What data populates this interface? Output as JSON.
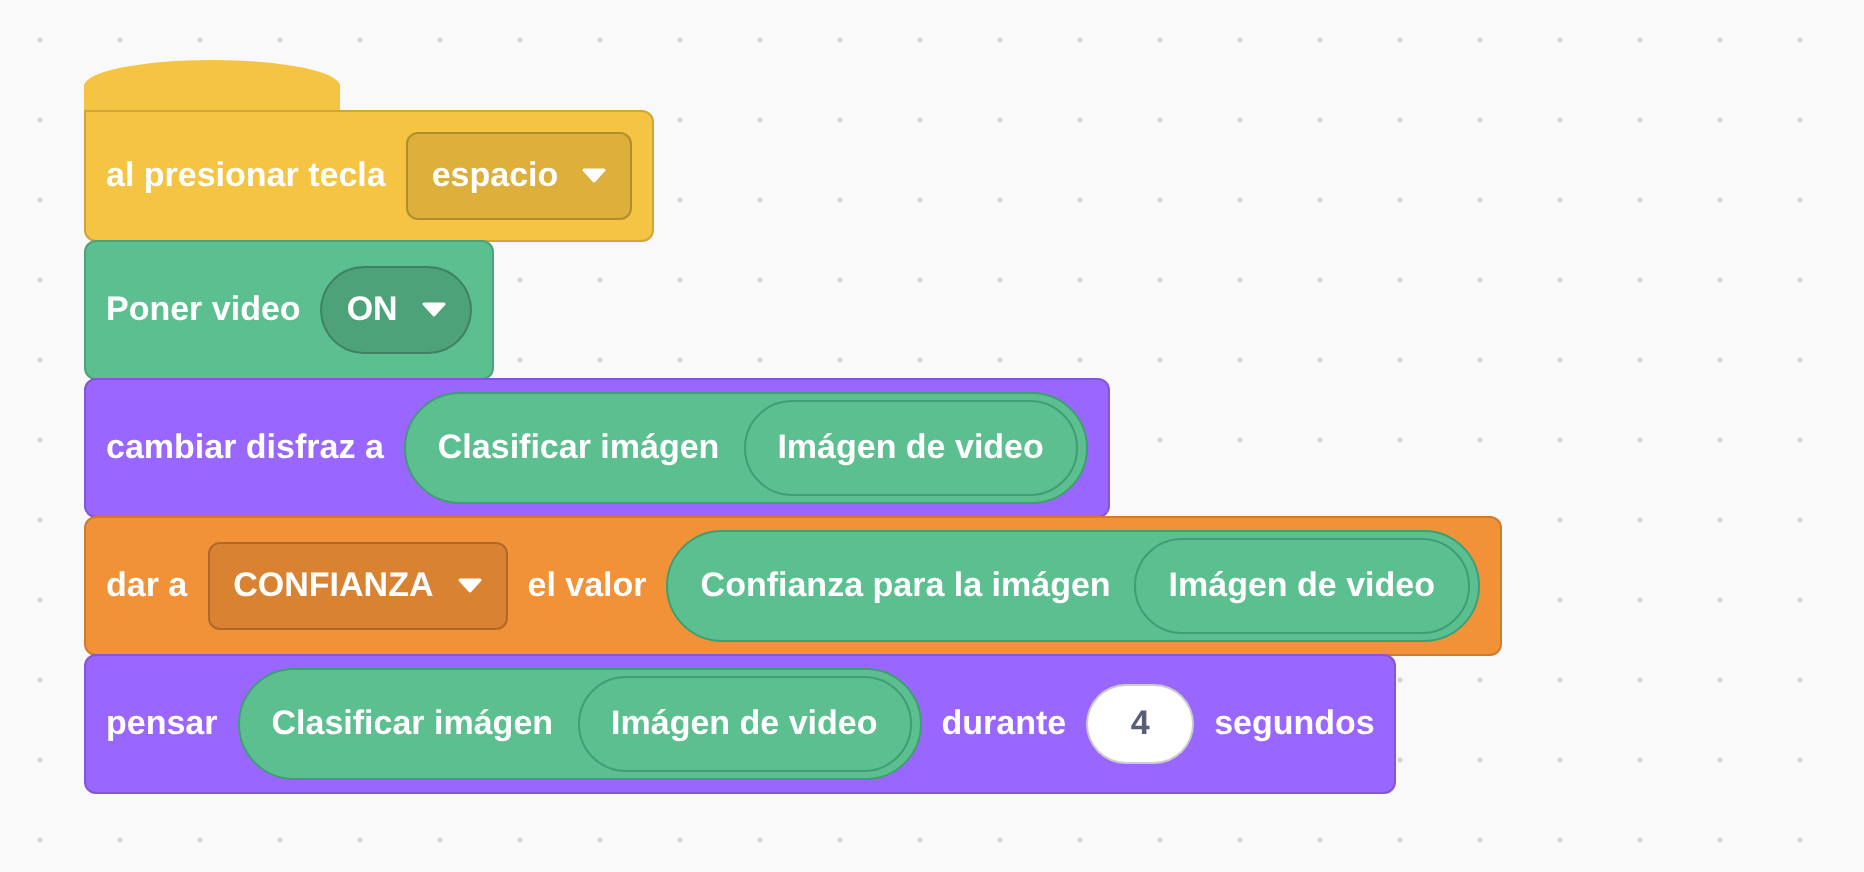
{
  "script": [
    {
      "kind": "hat",
      "color": "#f6c443",
      "parts": [
        {
          "kind": "label",
          "text": "al presionar tecla"
        },
        {
          "kind": "dropdown",
          "text": "espacio"
        }
      ]
    },
    {
      "kind": "stack",
      "color": "#5cbf8f",
      "parts": [
        {
          "kind": "label",
          "text": "Poner video"
        },
        {
          "kind": "pill-dropdown",
          "text": "ON"
        }
      ]
    },
    {
      "kind": "stack",
      "color": "#9966ff",
      "parts": [
        {
          "kind": "label",
          "text": "cambiar disfraz a"
        },
        {
          "kind": "reporter",
          "text": "Clasificar imágen",
          "inner": "Imágen de video"
        }
      ]
    },
    {
      "kind": "stack",
      "color": "#f29238",
      "parts": [
        {
          "kind": "label",
          "text": "dar a"
        },
        {
          "kind": "dropdown",
          "text": "CONFIANZA"
        },
        {
          "kind": "label",
          "text": "el valor"
        },
        {
          "kind": "reporter",
          "text": "Confianza para la imágen",
          "inner": "Imágen de video"
        }
      ]
    },
    {
      "kind": "stack",
      "color": "#9966ff",
      "parts": [
        {
          "kind": "label",
          "text": "pensar"
        },
        {
          "kind": "reporter",
          "text": "Clasificar imágen",
          "inner": "Imágen de video"
        },
        {
          "kind": "label",
          "text": "durante"
        },
        {
          "kind": "number",
          "text": "4"
        },
        {
          "kind": "label",
          "text": "segundos"
        }
      ]
    }
  ]
}
